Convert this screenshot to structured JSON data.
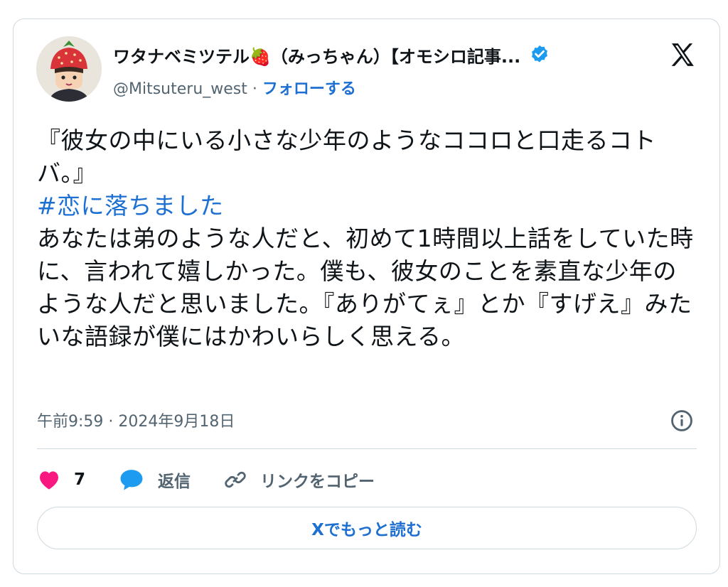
{
  "author": {
    "display_name": "ワタナベミツテル🍓（みっちゃん）【オモシロ記事...",
    "handle": "@Mitsuteru_west",
    "separator": " · ",
    "follow_label": "フォローする",
    "verified": true
  },
  "tweet": {
    "text_line_1": "『彼女の中にいる小さな少年のようなココロと口走るコトバ。』",
    "hashtag": "#恋に落ちました",
    "text_body": "あなたは弟のような人だと、初めて1時間以上話をしていた時に、言われて嬉しかった。僕も、彼女のことを素直な少年のような人だと思いました。『ありがてぇ』とか『すげえ』みたいな語録が僕にはかわいらしく思える。",
    "timestamp": "午前9:59 · 2024年9月18日"
  },
  "actions": {
    "like_count": "7",
    "reply_label": "返信",
    "copy_link_label": "リンクをコピー"
  },
  "read_more_label": "Xでもっと読む",
  "colors": {
    "link_blue": "#1d6fd1",
    "like_pink": "#f91880",
    "reply_blue": "#1d9bf0",
    "verified_blue": "#1d9bf0",
    "border": "#cfd9de",
    "secondary_text": "#536471"
  },
  "icons": [
    "avatar-strawberry-hat",
    "verified-badge-icon",
    "x-logo-icon",
    "info-icon",
    "heart-icon",
    "reply-bubble-icon",
    "link-icon"
  ]
}
